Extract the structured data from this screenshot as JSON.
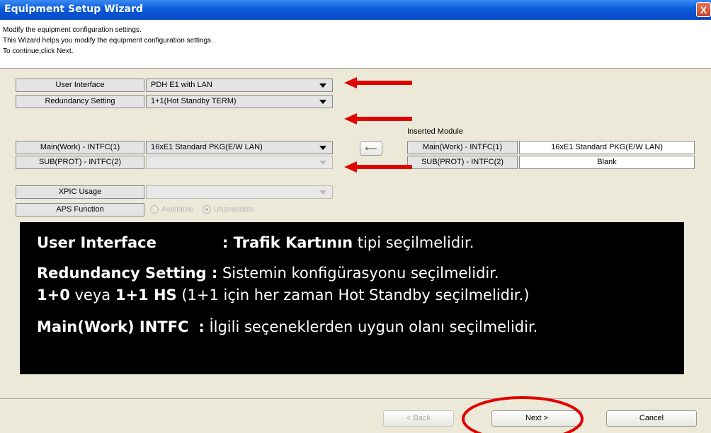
{
  "window": {
    "title": "Equipment Setup Wizard",
    "close_label": "X"
  },
  "header": {
    "line1": "Modify the equipment configuration settings.",
    "line2": "This Wizard helps you modify the equipment configuration settings.",
    "line3": "To continue,click Next."
  },
  "form": {
    "user_interface": {
      "label": "User Interface",
      "value": "PDH E1 with LAN"
    },
    "redundancy": {
      "label": "Redundancy Setting",
      "value": "1+1(Hot Standby TERM)"
    },
    "main_intfc": {
      "label": "Main(Work) - INTFC(1)",
      "value": "16xE1 Standard PKG(E/W LAN)"
    },
    "sub_intfc": {
      "label": "SUB(PROT) - INTFC(2)",
      "value": ""
    },
    "xpic": {
      "label": "XPIC Usage",
      "value": ""
    },
    "aps": {
      "label": "APS Function",
      "options": [
        "Available",
        "Unavailable"
      ],
      "selected": "Unavailable"
    }
  },
  "inserted_module": {
    "title": "Inserted Module",
    "rows": [
      {
        "label": "Main(Work) - INTFC(1)",
        "value": "16xE1 Standard PKG(E/W LAN)"
      },
      {
        "label": "SUB(PROT) - INTFC(2)",
        "value": "Blank"
      }
    ],
    "copy_icon": "left-arrow-icon"
  },
  "overlay": {
    "l1_bold": "User Interface",
    "l1_sep": ": ",
    "l1_bold2": "Trafik Kartının",
    "l1_rest": " tipi seçilmelidir.",
    "l2_bold": "Redundancy Setting :",
    "l2_rest": " Sistemin konfigürasyonu seçilmelidir.",
    "l3_bold1": "1+0",
    "l3_mid": " veya ",
    "l3_bold2": "1+1 HS",
    "l3_rest": " (1+1 için her zaman Hot Standby seçilmelidir.)",
    "l4_bold": "Main(Work) INTFC",
    "l4_sep": ":",
    "l4_rest": " İlgili seçeneklerden uygun olanı seçilmelidir."
  },
  "buttons": {
    "back": "< Back",
    "next": "Next >",
    "cancel": "Cancel"
  },
  "colors": {
    "annotation": "#e00000",
    "title_bar": "#0a5ad7"
  }
}
